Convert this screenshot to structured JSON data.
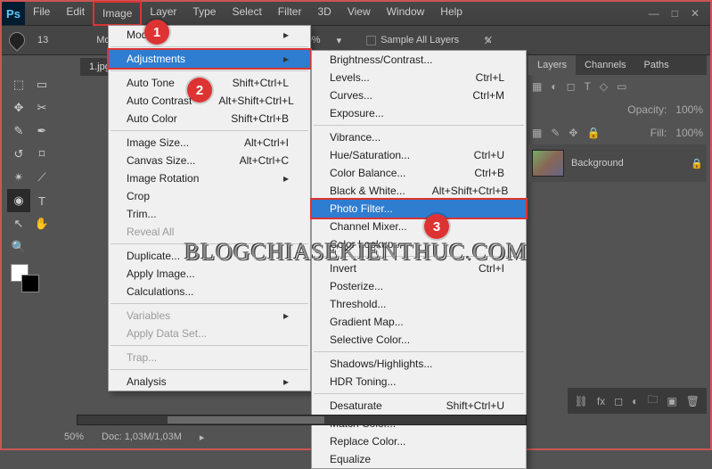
{
  "topmenu": {
    "items": [
      "File",
      "Edit",
      "Image",
      "Layer",
      "Type",
      "Select",
      "Filter",
      "3D",
      "View",
      "Window",
      "Help"
    ],
    "highlighted_index": 2
  },
  "window_controls": {
    "min": "—",
    "max": "□",
    "close": "✕"
  },
  "options_bar": {
    "brush_size": "13",
    "mode_label": "Mo",
    "opacity_value": "50%",
    "sample_all_label": "Sample All Layers"
  },
  "document_tab": "1.jpg",
  "image_menu": {
    "items": [
      {
        "label": "Mode",
        "shortcut": "",
        "arrow": true
      },
      {
        "label": "Adjustments",
        "shortcut": "",
        "arrow": true,
        "highlight": true
      },
      {
        "label": "Auto Tone",
        "shortcut": "Shift+Ctrl+L"
      },
      {
        "label": "Auto Contrast",
        "shortcut": "Alt+Shift+Ctrl+L"
      },
      {
        "label": "Auto Color",
        "shortcut": "Shift+Ctrl+B"
      },
      {
        "label": "Image Size...",
        "shortcut": "Alt+Ctrl+I"
      },
      {
        "label": "Canvas Size...",
        "shortcut": "Alt+Ctrl+C"
      },
      {
        "label": "Image Rotation",
        "shortcut": "",
        "arrow": true
      },
      {
        "label": "Crop",
        "shortcut": ""
      },
      {
        "label": "Trim...",
        "shortcut": ""
      },
      {
        "label": "Reveal All",
        "shortcut": "",
        "disabled": true
      },
      {
        "label": "Duplicate...",
        "shortcut": ""
      },
      {
        "label": "Apply Image...",
        "shortcut": ""
      },
      {
        "label": "Calculations...",
        "shortcut": ""
      },
      {
        "label": "Variables",
        "shortcut": "",
        "arrow": true,
        "disabled": true
      },
      {
        "label": "Apply Data Set...",
        "shortcut": "",
        "disabled": true
      },
      {
        "label": "Trap...",
        "shortcut": "",
        "disabled": true
      },
      {
        "label": "Analysis",
        "shortcut": "",
        "arrow": true
      }
    ],
    "separators_after": [
      0,
      1,
      4,
      10,
      13,
      15,
      16
    ]
  },
  "adjustments_menu": {
    "items": [
      {
        "label": "Brightness/Contrast...",
        "shortcut": ""
      },
      {
        "label": "Levels...",
        "shortcut": "Ctrl+L"
      },
      {
        "label": "Curves...",
        "shortcut": "Ctrl+M"
      },
      {
        "label": "Exposure...",
        "shortcut": ""
      },
      {
        "label": "Vibrance...",
        "shortcut": ""
      },
      {
        "label": "Hue/Saturation...",
        "shortcut": "Ctrl+U"
      },
      {
        "label": "Color Balance...",
        "shortcut": "Ctrl+B"
      },
      {
        "label": "Black & White...",
        "shortcut": "Alt+Shift+Ctrl+B"
      },
      {
        "label": "Photo Filter...",
        "shortcut": "",
        "highlight": true
      },
      {
        "label": "Channel Mixer...",
        "shortcut": ""
      },
      {
        "label": "Color Lookup...",
        "shortcut": ""
      },
      {
        "label": "Invert",
        "shortcut": "Ctrl+I"
      },
      {
        "label": "Posterize...",
        "shortcut": ""
      },
      {
        "label": "Threshold...",
        "shortcut": ""
      },
      {
        "label": "Gradient Map...",
        "shortcut": ""
      },
      {
        "label": "Selective Color...",
        "shortcut": ""
      },
      {
        "label": "Shadows/Highlights...",
        "shortcut": ""
      },
      {
        "label": "HDR Toning...",
        "shortcut": ""
      },
      {
        "label": "Desaturate",
        "shortcut": "Shift+Ctrl+U"
      },
      {
        "label": "Match Color...",
        "shortcut": ""
      },
      {
        "label": "Replace Color...",
        "shortcut": ""
      },
      {
        "label": "Equalize",
        "shortcut": ""
      }
    ],
    "separators_after": [
      3,
      10,
      15,
      17
    ]
  },
  "panels": {
    "tabs": [
      "Layers",
      "Channels",
      "Paths"
    ],
    "active_tab": 0,
    "opacity_label": "Opacity:",
    "opacity_value": "100%",
    "fill_label": "Fill:",
    "fill_value": "100%",
    "layer_name": "Background",
    "lock_icon": "🔒"
  },
  "status": {
    "zoom": "50%",
    "doc": "Doc:  1,03M/1,03M"
  },
  "callouts": {
    "one": "1",
    "two": "2",
    "three": "3"
  },
  "watermark": "BLOGCHIASEKIENTHUC.COM",
  "tool_icons": [
    "⬚",
    "▭",
    "✥",
    "✂",
    "✎",
    "✒",
    "↺",
    "⌑",
    "✴",
    "⟋",
    "◉",
    "T",
    "↖",
    "✋",
    "🔍",
    ""
  ]
}
